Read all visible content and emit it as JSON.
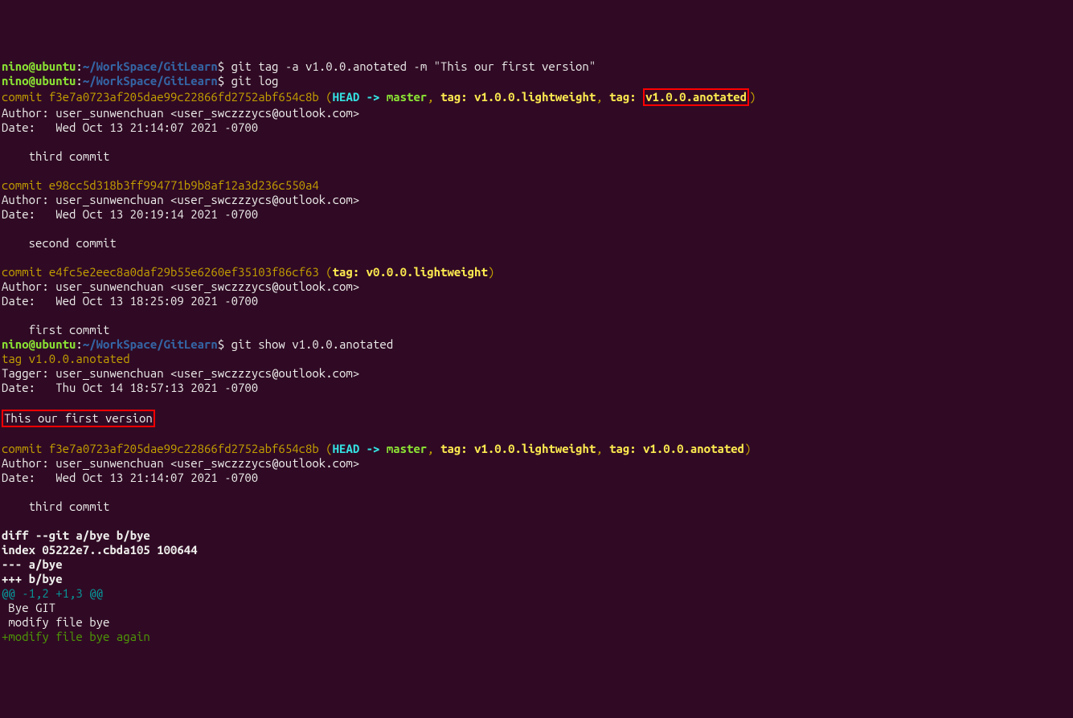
{
  "prompt": {
    "user": "nino@ubuntu",
    "sep": ":",
    "path": "~/WorkSpace/GitLearn",
    "dollar": "$"
  },
  "cmd1": " git tag -a v1.0.0.anotated -m \"This our first version\"",
  "cmd2": " git log",
  "cmd3": " git show v1.0.0.anotated",
  "commit1": {
    "label": "commit ",
    "hash": "f3e7a0723af205dae99c22866fd2752abf654c8b",
    "open": " (",
    "head": "HEAD -> ",
    "master": "master",
    "comma1": ", ",
    "tag1_label": "tag: v1.0.0.lightweight",
    "comma2": ", ",
    "tag2_label": "tag: ",
    "tag2_name": "v1.0.0.anotated",
    "close": ")",
    "author": "Author: user_sunwenchuan <user_swczzzycs@outlook.com>",
    "date": "Date:   Wed Oct 13 21:14:07 2021 -0700",
    "msg": "    third commit"
  },
  "commit2": {
    "line": "commit e98cc5d318b3ff994771b9b8af12a3d236c550a4",
    "author": "Author: user_sunwenchuan <user_swczzzycs@outlook.com>",
    "date": "Date:   Wed Oct 13 20:19:14 2021 -0700",
    "msg": "    second commit"
  },
  "commit3": {
    "label": "commit ",
    "hash": "e4fc5e2eec8a0daf29b55e6260ef35103f86cf63",
    "open": " (",
    "tag_label": "tag: v0.0.0.lightweight",
    "close": ")",
    "author": "Author: user_sunwenchuan <user_swczzzycs@outlook.com>",
    "date": "Date:   Wed Oct 13 18:25:09 2021 -0700",
    "msg": "    first commit"
  },
  "tag_out": {
    "line": "tag v1.0.0.anotated",
    "tagger": "Tagger: user_sunwenchuan <user_swczzzycs@outlook.com>",
    "date": "Date:   Thu Oct 14 18:57:13 2021 -0700",
    "msg": "This our first version"
  },
  "commit4": {
    "label": "commit ",
    "hash": "f3e7a0723af205dae99c22866fd2752abf654c8b",
    "open": " (",
    "head": "HEAD -> ",
    "master": "master",
    "comma1": ", ",
    "tag1_label": "tag: v1.0.0.lightweight",
    "comma2": ", ",
    "tag2_label": "tag: v1.0.0.anotated",
    "close": ")",
    "author": "Author: user_sunwenchuan <user_swczzzycs@outlook.com>",
    "date": "Date:   Wed Oct 13 21:14:07 2021 -0700",
    "msg": "    third commit"
  },
  "diff": {
    "header1": "diff --git a/bye b/bye",
    "header2": "index 05222e7..cbda105 100644",
    "header3": "--- a/bye",
    "header4": "+++ b/bye",
    "hunk": "@@ -1,2 +1,3 @@",
    "ctx1": " Bye GIT",
    "ctx2": " modify file bye",
    "add1": "+modify file bye again"
  }
}
